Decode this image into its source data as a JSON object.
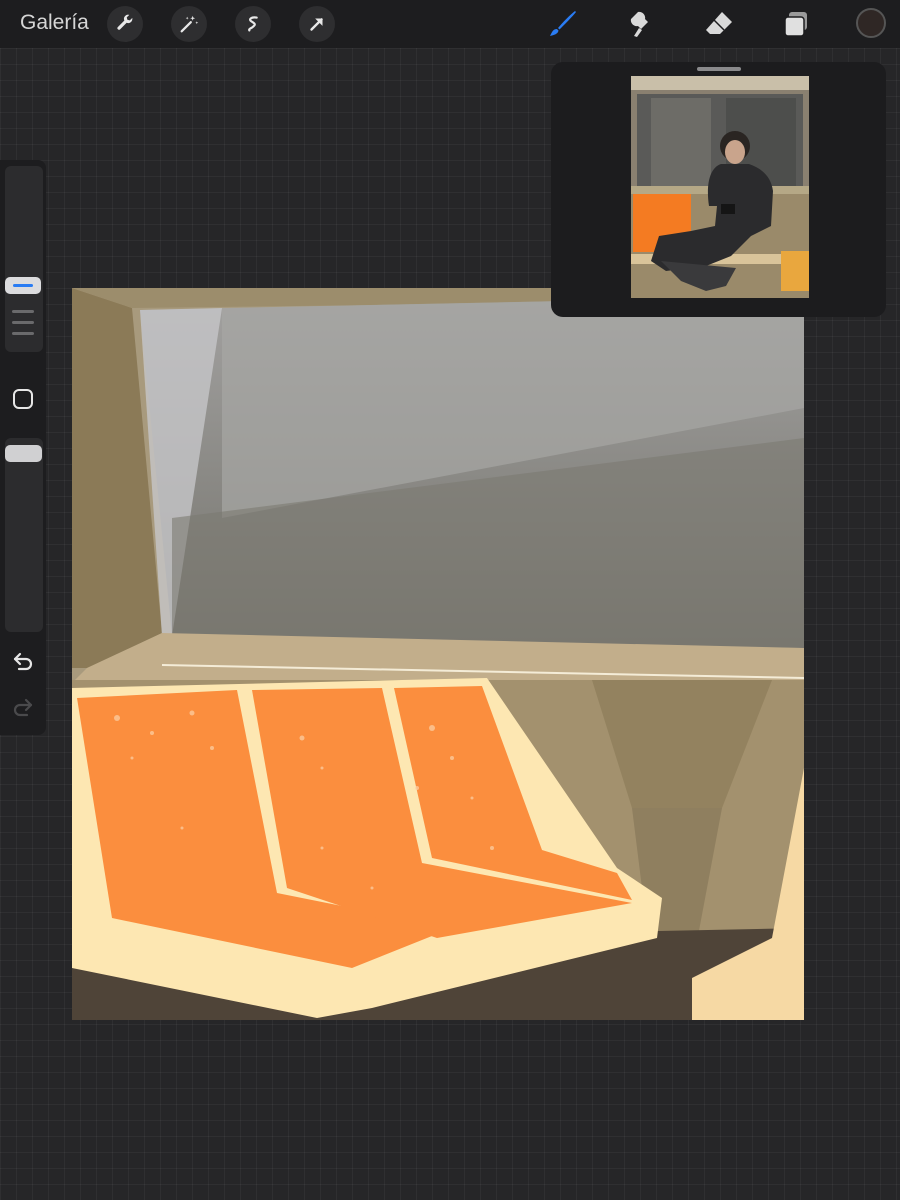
{
  "topbar": {
    "gallery_label": "Galería",
    "left_tools": [
      "wrench-icon",
      "magic-wand-icon",
      "selection-icon",
      "transform-arrow-icon"
    ],
    "right_tools": [
      "brush-icon",
      "smudge-icon",
      "eraser-icon",
      "layers-icon"
    ],
    "active_tool": "brush-icon",
    "current_color": "#2f2725",
    "accent_color": "#2a7cf3"
  },
  "sidebar": {
    "controls": [
      "brush-size-slider",
      "opacity-slider",
      "modify-square-icon",
      "undo-icon",
      "redo-icon"
    ]
  },
  "canvas": {
    "seat_color": "#fb8e3e",
    "trim_color": "#fde7b2",
    "wall_color": "#a89a7d",
    "window_color": "#8e8d88"
  },
  "reference": {
    "content": "subway-photo"
  }
}
